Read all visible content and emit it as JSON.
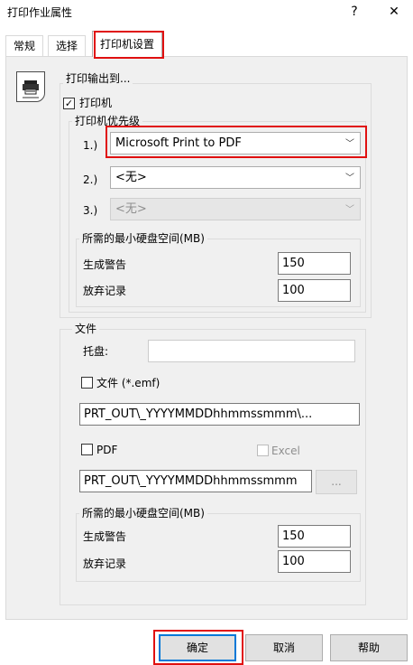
{
  "window": {
    "title": "打印作业属性",
    "help_glyph": "?",
    "close_glyph": "✕"
  },
  "tabs": [
    {
      "label": "常规"
    },
    {
      "label": "选择"
    },
    {
      "label": "打印机设置"
    }
  ],
  "output": {
    "heading": "打印输出到...",
    "printer_checkbox_label": "打印机",
    "printer_checked": true
  },
  "priority": {
    "heading": "打印机优先级",
    "rows": [
      {
        "num": "1.)",
        "value": "Microsoft Print to PDF",
        "enabled": true
      },
      {
        "num": "2.)",
        "value": "<无>",
        "enabled": true
      },
      {
        "num": "3.)",
        "value": "<无>",
        "enabled": false
      }
    ]
  },
  "disk1": {
    "heading": "所需的最小硬盘空间(MB)",
    "warn_label": "生成警告",
    "warn_value": "150",
    "abort_label": "放弃记录",
    "abort_value": "100"
  },
  "file": {
    "heading": "文件",
    "tray_label": "托盘:",
    "tray_value": "",
    "emf_label": "文件 (*.emf)",
    "emf_checked": false,
    "emf_path": "PRT_OUT\\_YYYYMMDDhhmmssmmm\\...",
    "pdf_label": "PDF",
    "pdf_checked": false,
    "excel_label": "Excel",
    "excel_checked": false,
    "pdf_path": "PRT_OUT\\_YYYYMMDDhhmmssmmm",
    "browse_label": "..."
  },
  "disk2": {
    "heading": "所需的最小硬盘空间(MB)",
    "warn_label": "生成警告",
    "warn_value": "150",
    "abort_label": "放弃记录",
    "abort_value": "100"
  },
  "footer": {
    "ok_label": "确定",
    "cancel_label": "取消",
    "help_label": "帮助"
  },
  "colors": {
    "highlight": "#e01010",
    "focus_blue": "#0078d7",
    "panel_bg": "#f0f0f0"
  }
}
